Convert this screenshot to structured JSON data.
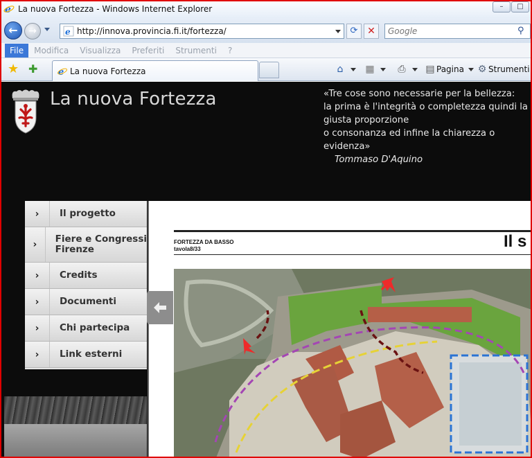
{
  "window": {
    "title": "La nuova Fortezza - Windows Internet Explorer"
  },
  "address_bar": {
    "url": "http://innova.provincia.fi.it/fortezza/"
  },
  "search": {
    "placeholder": "Google"
  },
  "menu": {
    "items": [
      "File",
      "Modifica",
      "Visualizza",
      "Preferiti",
      "Strumenti",
      "?"
    ]
  },
  "tab": {
    "label": "La nuova Fortezza"
  },
  "commands": {
    "pagina": "Pagina",
    "strumenti": "Strumenti"
  },
  "site": {
    "title": "La nuova Fortezza",
    "quote_lines": [
      "«Tre cose sono necessarie per la bellezza:",
      "la prima è l'integrità o completezza quindi la",
      "giusta proporzione",
      "o consonanza ed infine la chiarezza o",
      "evidenza»"
    ],
    "quote_author": "Tommaso D'Aquino"
  },
  "nav": {
    "items": [
      {
        "label": "Il progetto"
      },
      {
        "label_line1": "Fiere e Congressi",
        "label_line2": "Firenze"
      },
      {
        "label": "Credits"
      },
      {
        "label": "Documenti"
      },
      {
        "label": "Chi partecipa"
      },
      {
        "label": "Link esterni"
      }
    ]
  },
  "document": {
    "header_line1": "FORTEZZA DA BASSO",
    "header_line2": "tavola8/33",
    "header_right": "Il s"
  }
}
